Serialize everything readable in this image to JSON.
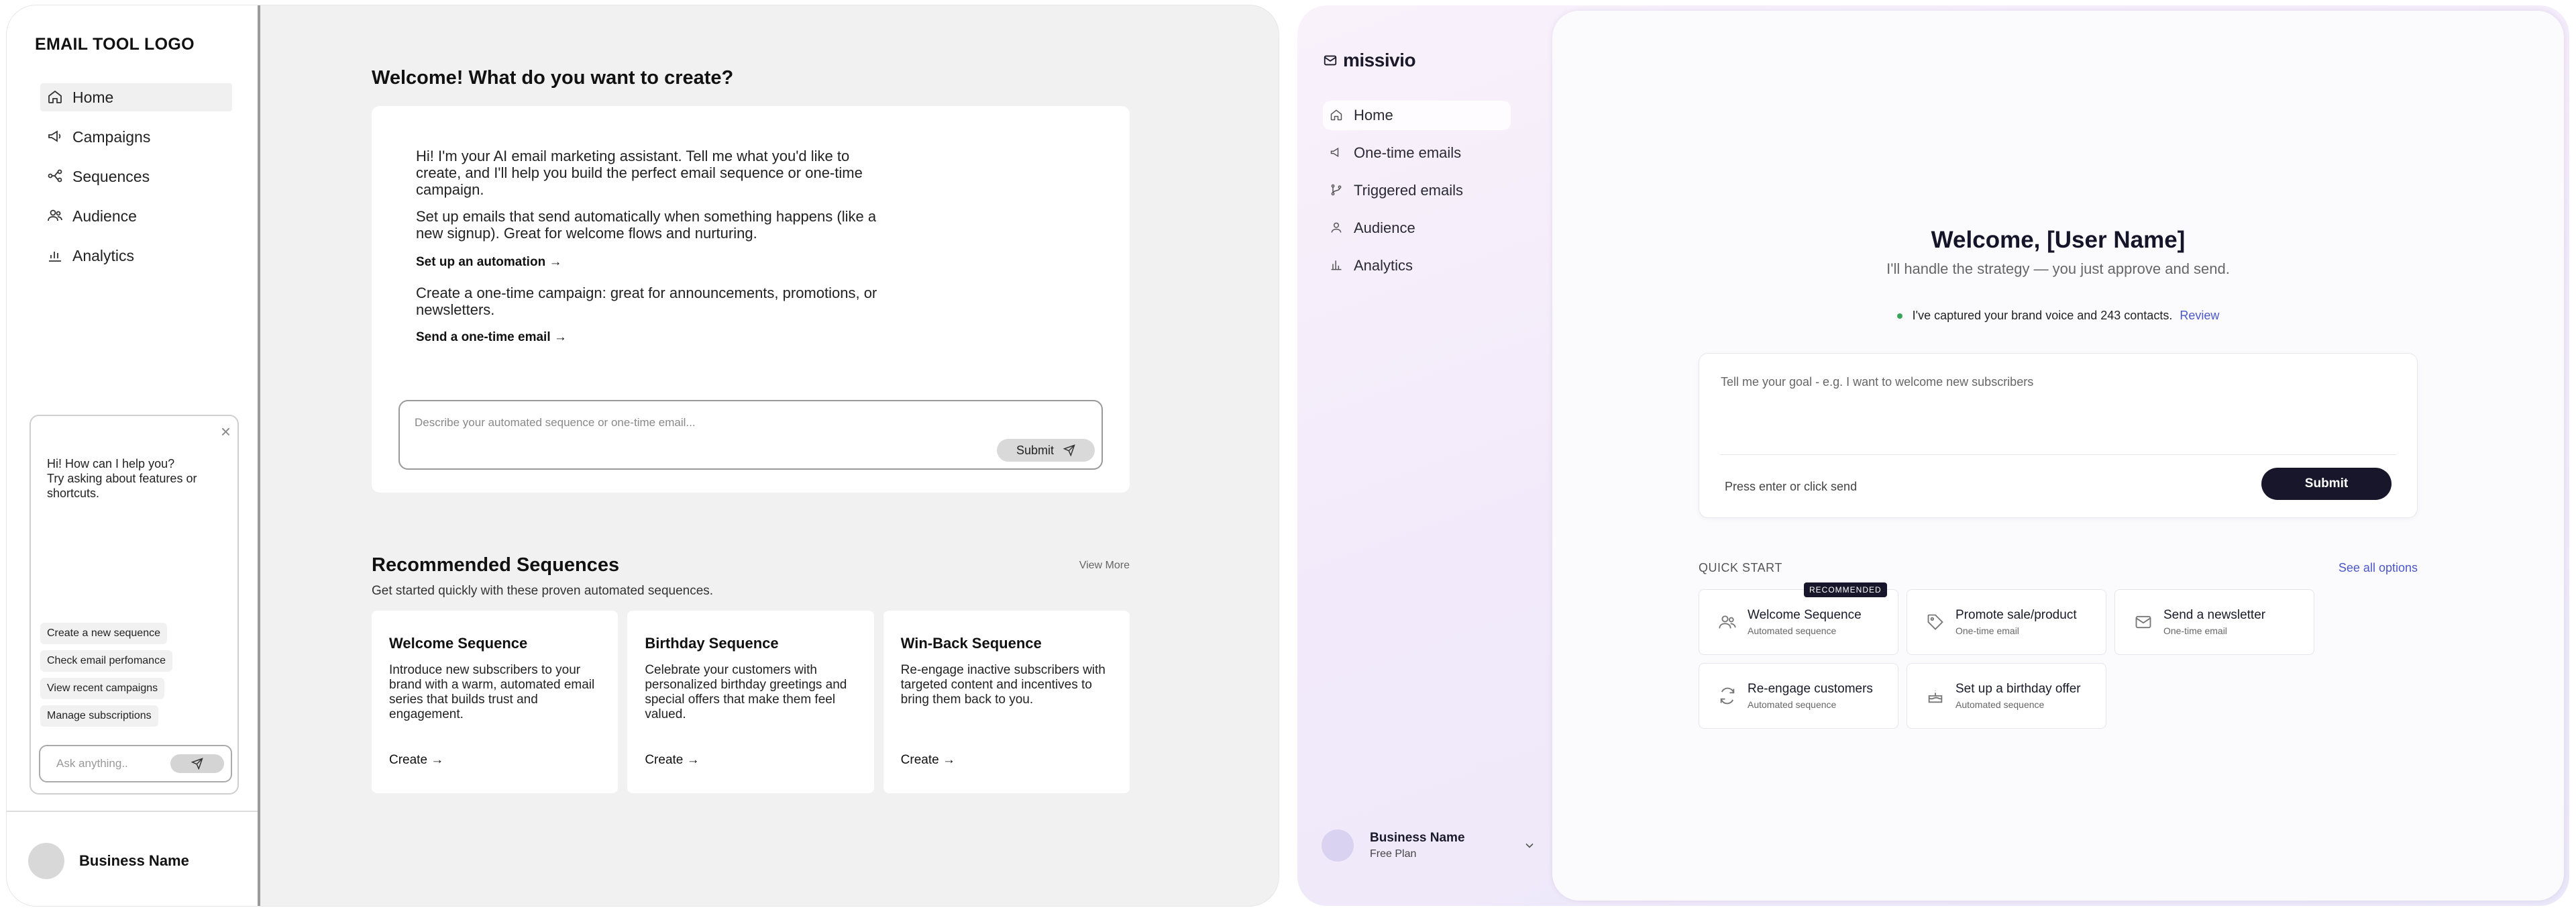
{
  "left": {
    "logo": "EMAIL TOOL LOGO",
    "nav": [
      {
        "label": "Home",
        "icon": "home-icon"
      },
      {
        "label": "Campaigns",
        "icon": "megaphone-icon"
      },
      {
        "label": "Sequences",
        "icon": "sequence-icon"
      },
      {
        "label": "Audience",
        "icon": "users-icon"
      },
      {
        "label": "Analytics",
        "icon": "bar-chart-icon"
      }
    ],
    "chat": {
      "message_line1": "Hi! How can I help you?",
      "message_line2": "Try asking about features or shortcuts.",
      "chips": [
        "Create a new sequence",
        "Check email perfomance",
        "View recent campaigns",
        "Manage subscriptions"
      ],
      "input_placeholder": "Ask anything.."
    },
    "user": {
      "name": "Business Name"
    },
    "main": {
      "welcome": "Welcome! What do you want to create?",
      "intro": "Hi! I'm your AI email marketing assistant. Tell me what you'd like to create, and I'll help you build the perfect email sequence or one-time campaign.",
      "automation_text": "Set up emails that send automatically when something happens (like a new signup). Great for welcome flows and nurturing.",
      "automation_link": "Set up an automation →",
      "onetime_text": "Create a one-time campaign: great for announcements, promotions, or newsletters.",
      "onetime_link": "Send a one-time email →",
      "input_placeholder": "Describe your automated sequence or one-time email...",
      "submit_label": "Submit"
    },
    "recommended": {
      "title": "Recommended Sequences",
      "view_more": "View More",
      "subtitle": "Get started quickly with these proven automated sequences.",
      "cards": [
        {
          "title": "Welcome Sequence",
          "desc": "Introduce new subscribers to your brand with a warm, automated email series that builds trust and engagement.",
          "cta": "Create →"
        },
        {
          "title": "Birthday Sequence",
          "desc": "Celebrate your customers with personalized birthday greetings and special offers that make them feel valued.",
          "cta": "Create →"
        },
        {
          "title": "Win-Back Sequence",
          "desc": "Re-engage inactive subscribers with targeted content and incentives to bring them back to you.",
          "cta": "Create →"
        }
      ]
    }
  },
  "right": {
    "logo": "missivio",
    "nav": [
      {
        "label": "Home",
        "icon": "home-icon"
      },
      {
        "label": "One-time emails",
        "icon": "megaphone-icon"
      },
      {
        "label": "Triggered emails",
        "icon": "branch-icon"
      },
      {
        "label": "Audience",
        "icon": "user-icon"
      },
      {
        "label": "Analytics",
        "icon": "chart-icon"
      }
    ],
    "user": {
      "name": "Business Name",
      "plan": "Free Plan"
    },
    "main": {
      "welcome": "Welcome, [User Name]",
      "tagline": "I'll handle the strategy — you just approve and send.",
      "status": "I've captured your brand voice and 243 contacts.",
      "review_link": "Review",
      "prompt_placeholder": "Tell me your goal - e.g. I want to welcome new subscribers",
      "prompt_hint": "Press enter or click send",
      "submit_label": "Submit"
    },
    "quick_start": {
      "label": "QUICK START",
      "see_all": "See all options",
      "badge": "RECOMMENDED",
      "cards": [
        {
          "title": "Welcome Sequence",
          "sub": "Automated sequence",
          "icon": "users-icon"
        },
        {
          "title": "Promote sale/product",
          "sub": "One-time email",
          "icon": "tag-icon"
        },
        {
          "title": "Send a newsletter",
          "sub": "One-time email",
          "icon": "mail-icon"
        },
        {
          "title": "Re-engage customers",
          "sub": "Automated sequence",
          "icon": "refresh-icon"
        },
        {
          "title": "Set up a birthday offer",
          "sub": "Automated sequence",
          "icon": "cake-icon"
        }
      ]
    },
    "colors": {
      "accent": "#4b57c9",
      "dark": "#17162a",
      "status_green": "#3aa35a"
    }
  }
}
